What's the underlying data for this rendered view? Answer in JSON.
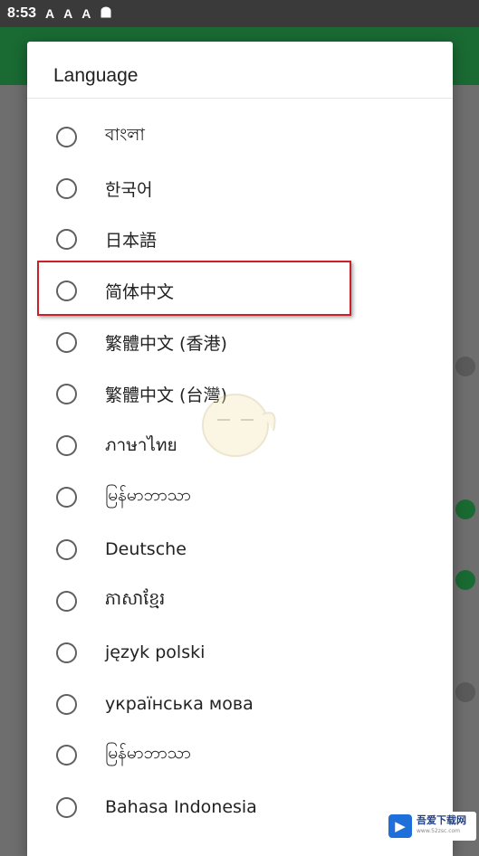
{
  "status_bar": {
    "time": "8:53",
    "icons": [
      "A",
      "A",
      "A",
      "android-icon"
    ]
  },
  "dialog": {
    "title": "Language",
    "selected_highlight": "简体中文",
    "options": [
      {
        "label": "বাংলা"
      },
      {
        "label": "한국어"
      },
      {
        "label": "日本語"
      },
      {
        "label": "简体中文"
      },
      {
        "label": "繁體中文 (香港)"
      },
      {
        "label": "繁體中文 (台灣)"
      },
      {
        "label": "ภาษาไทย"
      },
      {
        "label": "မြန်မာဘာသာ"
      },
      {
        "label": "Deutsche"
      },
      {
        "label": "ភាសាខ្មែរ"
      },
      {
        "label": "język polski"
      },
      {
        "label": "українська мова"
      },
      {
        "label": "မြန်မာဘာသာ"
      },
      {
        "label": "Bahasa Indonesia"
      }
    ]
  },
  "watermark": {
    "brand": "吾爱下载网",
    "sub": "www.52zsc.com"
  },
  "colors": {
    "appbar": "#1a6a33",
    "highlight_border": "#c9202a"
  }
}
